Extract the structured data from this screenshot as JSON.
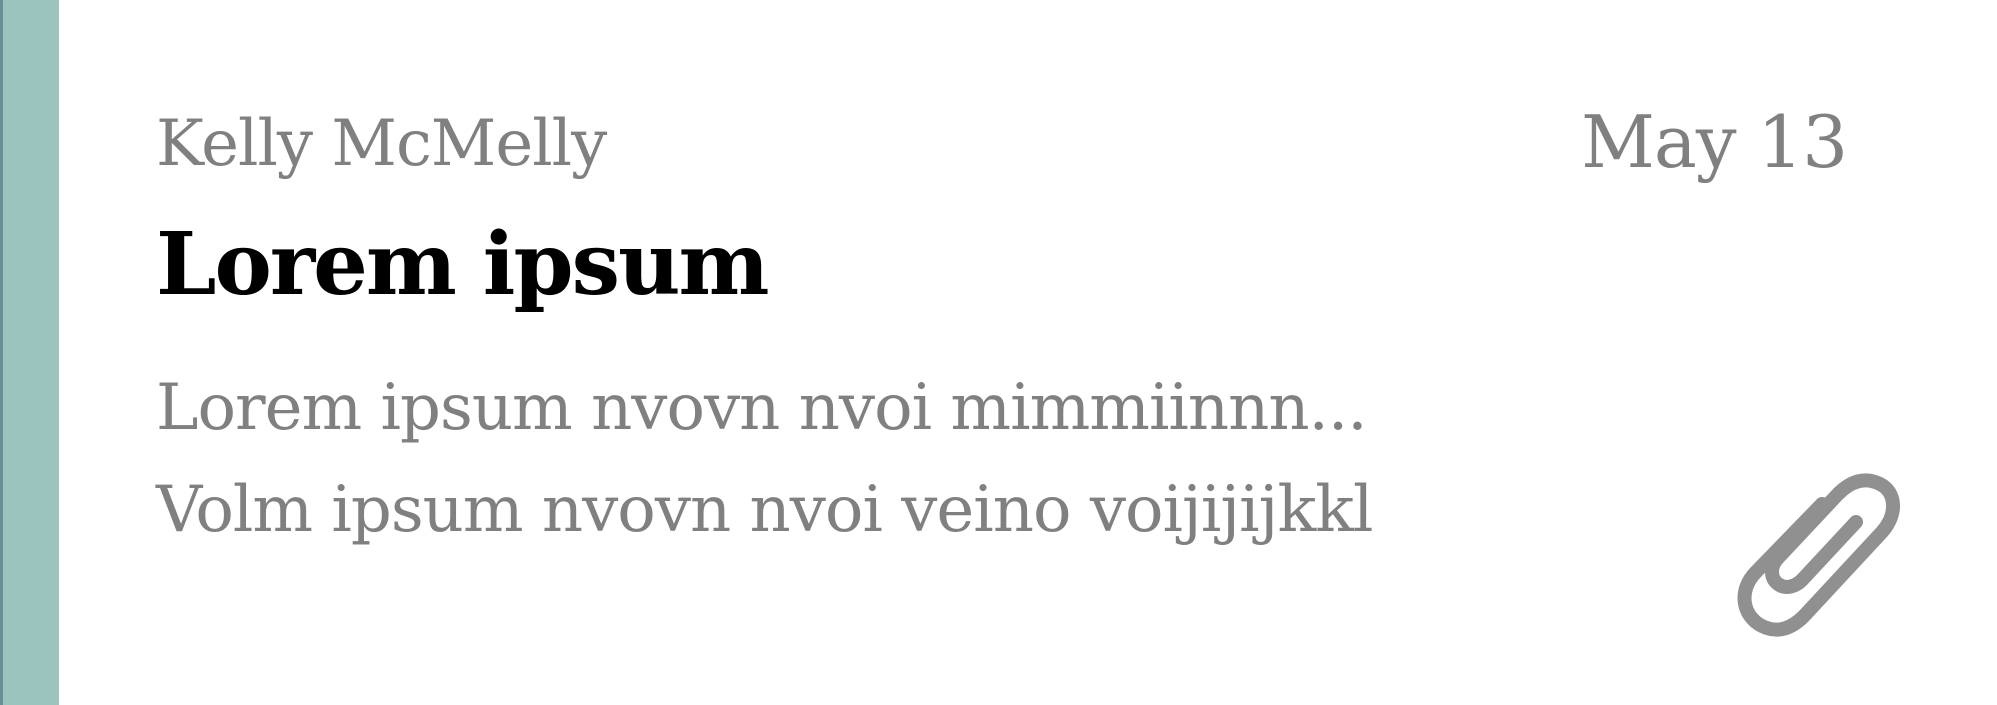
{
  "message": {
    "sender": "Kelly McMelly",
    "date": "May 13",
    "subject": "Lorem ipsum",
    "preview": [
      "Lorem ipsum nvovn nvoi mimmiinnn...",
      "Volm ipsum nvovn nvoi veino voijijijkkl"
    ],
    "attachment_icon": "paperclip-icon"
  },
  "colors": {
    "accent": "#9bc4bf",
    "accent_edge": "#6a8f9a",
    "muted_text": "#808080",
    "subject_text": "#000000",
    "background": "#ffffff"
  }
}
